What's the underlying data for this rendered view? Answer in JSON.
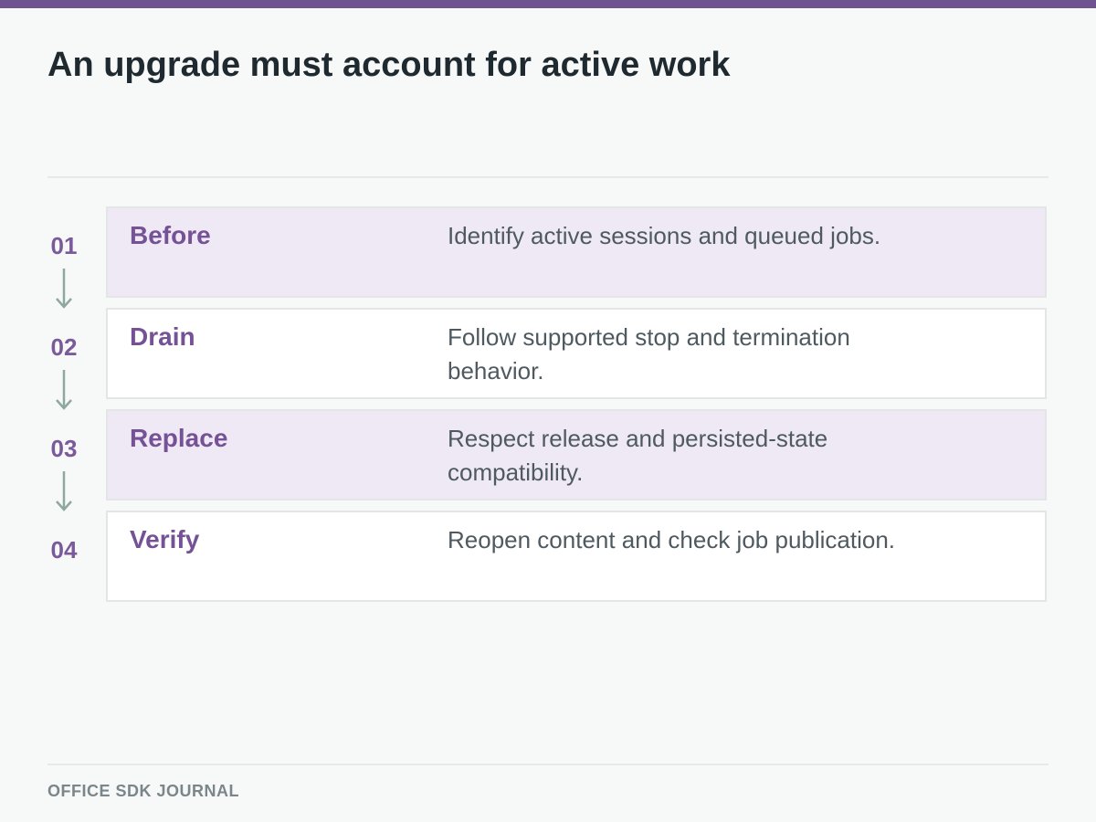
{
  "title": "An upgrade must account for active work",
  "steps": [
    {
      "number": "01",
      "label": "Before",
      "description": "Identify active sessions and queued jobs."
    },
    {
      "number": "02",
      "label": "Drain",
      "description": "Follow supported stop and termination behavior."
    },
    {
      "number": "03",
      "label": "Replace",
      "description": "Respect release and persisted-state compatibility."
    },
    {
      "number": "04",
      "label": "Verify",
      "description": "Reopen content and check job publication."
    }
  ],
  "footer": "OFFICE SDK JOURNAL",
  "colors": {
    "accent": "#6f5391",
    "step_label": "#755196",
    "arrow": "#8fa89e",
    "shaded_card": "#efe9f5",
    "background": "#f7f8f8"
  },
  "icons": {
    "connector": "arrow-down-icon"
  }
}
